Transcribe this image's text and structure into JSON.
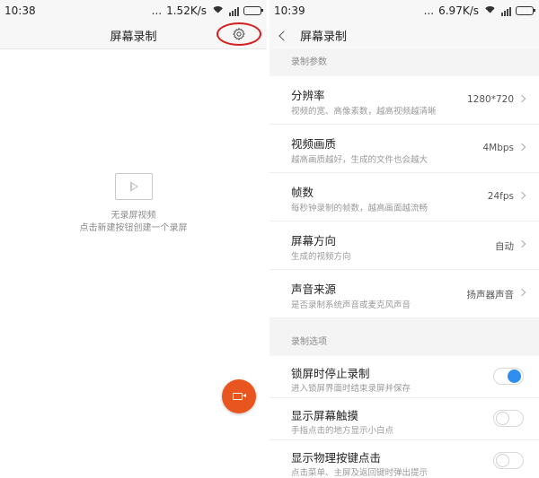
{
  "left": {
    "status": {
      "time": "10:38",
      "speed": "1.52K/s",
      "dots": "..."
    },
    "header": {
      "title": "屏幕录制",
      "settings_icon": "gear-icon",
      "highlight_color": "#d62020"
    },
    "empty": {
      "line1": "无录屏视频",
      "line2": "点击新建按钮创建一个录屏",
      "icon": "play-icon"
    },
    "fab": {
      "icon": "video-camera-icon",
      "color": "#e8551f"
    }
  },
  "right": {
    "status": {
      "time": "10:39",
      "speed": "6.97K/s",
      "dots": "..."
    },
    "header": {
      "title": "屏幕录制",
      "back_icon": "back-chevron-icon"
    },
    "section1": "录制参数",
    "params": [
      {
        "title": "分辨率",
        "subtitle": "视频的宽、高像素数，越高视频越清晰",
        "value": "1280*720"
      },
      {
        "title": "视频画质",
        "subtitle": "越高画质越好，生成的文件也会越大",
        "value": "4Mbps"
      },
      {
        "title": "帧数",
        "subtitle": "每秒钟录制的帧数，越高画面越流畅",
        "value": "24fps"
      },
      {
        "title": "屏幕方向",
        "subtitle": "生成的视频方向",
        "value": "自动"
      },
      {
        "title": "声音来源",
        "subtitle": "是否录制系统声音或麦克风声音",
        "value": "扬声器声音"
      }
    ],
    "section2": "录制选项",
    "options": [
      {
        "title": "锁屏时停止录制",
        "subtitle": "进入锁屏界面时结束录屏并保存",
        "on": true
      },
      {
        "title": "显示屏幕触摸",
        "subtitle": "手指点击的地方显示小白点",
        "on": false
      },
      {
        "title": "显示物理按键点击",
        "subtitle": "点击菜单、主屏及返回键时弹出提示",
        "on": false
      }
    ],
    "accent_color": "#2f8ef0"
  }
}
